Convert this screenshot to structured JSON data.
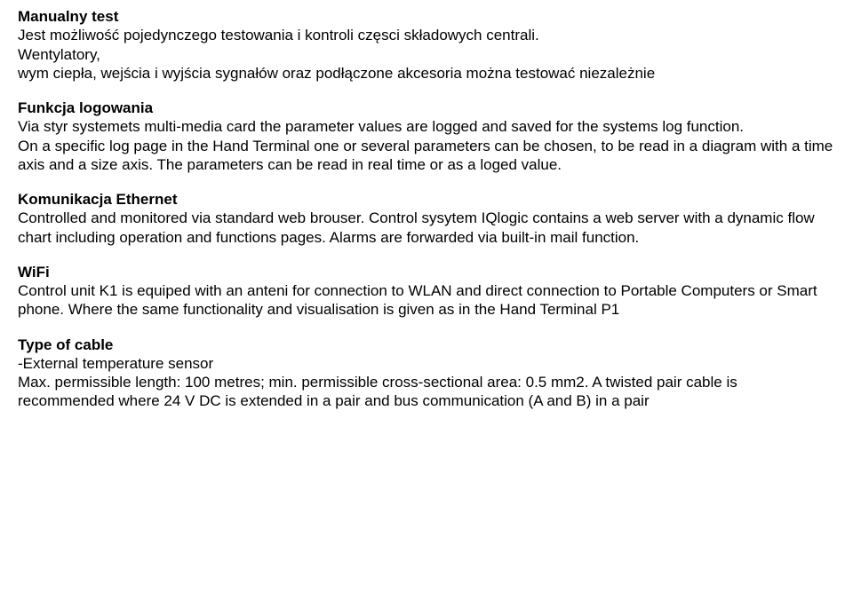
{
  "s1": {
    "heading": "Manualny test",
    "line1": "Jest możliwość pojedynczego testowania i kontroli częsci składowych centrali.",
    "line2": "Wentylatory,",
    "line3": "wym ciepła, wejścia i wyjścia sygnałów oraz podłączone akcesoria można testować niezależnie"
  },
  "s2": {
    "heading": "Funkcja logowania",
    "p1": "Via styr systemets multi-media card the parameter values are logged and saved for the systems log function.",
    "p2": "On a specific log page in the Hand Terminal one or several parameters can be chosen, to be read in a diagram with a time axis and a size axis. The parameters can be read in real time or as a loged value."
  },
  "s3": {
    "heading": "Komunikacja Ethernet",
    "p1": "Controlled and monitored via standard web brouser. Control sysytem IQlogic contains a web server with a dynamic flow chart including operation and functions pages. Alarms are forwarded via built-in mail function."
  },
  "s4": {
    "heading": "WiFi",
    "p1": "Control unit K1 is equiped with an anteni for connection to WLAN and direct connection to Portable Computers or Smart phone. Where the same functionality and visualisation is given as in the Hand Terminal P1"
  },
  "s5": {
    "heading": "Type of cable",
    "line1": "-External temperature sensor",
    "line2": "Max. permissible length: 100 metres; min. permissible cross-sectional area: 0.5 mm2. A twisted pair cable is recommended where 24 V DC is extended in a pair and bus communication (A and B) in a pair"
  }
}
